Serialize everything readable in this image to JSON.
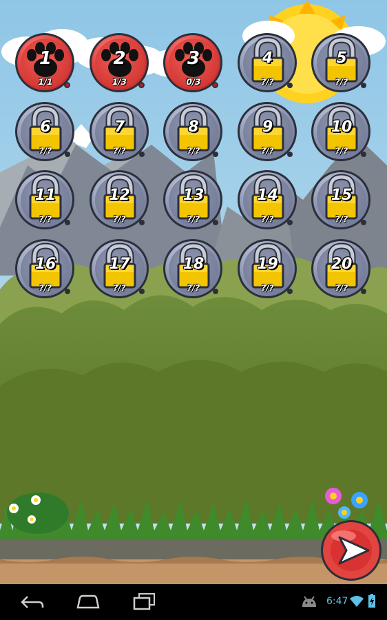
{
  "levels": [
    {
      "number": "1",
      "score": "1/1",
      "state": "unlocked"
    },
    {
      "number": "2",
      "score": "1/3",
      "state": "unlocked"
    },
    {
      "number": "3",
      "score": "0/3",
      "state": "unlocked"
    },
    {
      "number": "4",
      "score": "?/?",
      "state": "locked"
    },
    {
      "number": "5",
      "score": "?/?",
      "state": "locked"
    },
    {
      "number": "6",
      "score": "?/?",
      "state": "locked"
    },
    {
      "number": "7",
      "score": "?/?",
      "state": "locked"
    },
    {
      "number": "8",
      "score": "?/?",
      "state": "locked"
    },
    {
      "number": "9",
      "score": "?/?",
      "state": "locked"
    },
    {
      "number": "10",
      "score": "?/?",
      "state": "locked"
    },
    {
      "number": "11",
      "score": "?/?",
      "state": "locked"
    },
    {
      "number": "12",
      "score": "?/?",
      "state": "locked"
    },
    {
      "number": "13",
      "score": "?/?",
      "state": "locked"
    },
    {
      "number": "14",
      "score": "?/?",
      "state": "locked"
    },
    {
      "number": "15",
      "score": "?/?",
      "state": "locked"
    },
    {
      "number": "16",
      "score": "?/?",
      "state": "locked"
    },
    {
      "number": "17",
      "score": "?/?",
      "state": "locked"
    },
    {
      "number": "18",
      "score": "?/?",
      "state": "locked"
    },
    {
      "number": "19",
      "score": "?/?",
      "state": "locked"
    },
    {
      "number": "20",
      "score": "?/?",
      "state": "locked"
    }
  ],
  "next_button": {
    "icon": "arrow-right-icon"
  },
  "navbar": {
    "back_icon": "back-icon",
    "home_icon": "home-icon",
    "recents_icon": "recent-apps-icon"
  },
  "status": {
    "time": "6:47",
    "icons": [
      "android-icon",
      "wifi-icon",
      "battery-charging-icon"
    ]
  },
  "colors": {
    "sky": "#9ecde6",
    "unlocked": "#e2443f",
    "locked": "#8e98b4",
    "lock_gold": "#f3c400",
    "status_blue": "#5fc0e8"
  }
}
